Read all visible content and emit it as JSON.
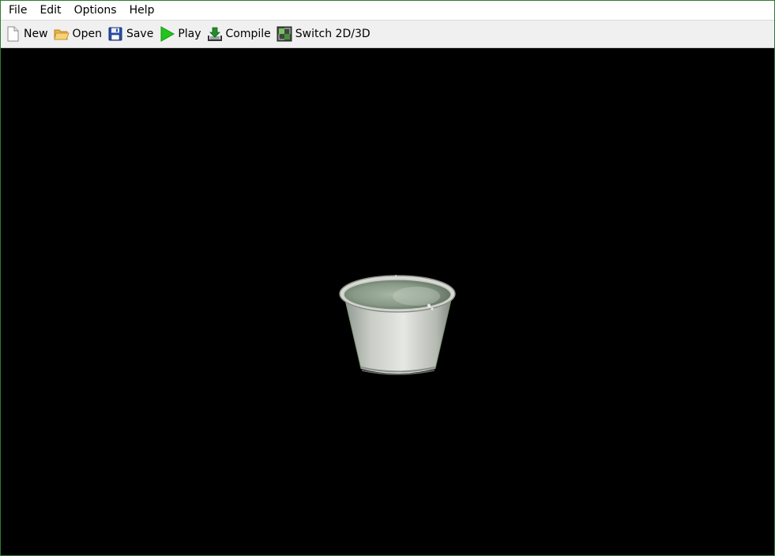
{
  "menubar": {
    "items": [
      {
        "label": "File"
      },
      {
        "label": "Edit"
      },
      {
        "label": "Options"
      },
      {
        "label": "Help"
      }
    ]
  },
  "toolbar": {
    "buttons": [
      {
        "label": "New",
        "icon": "new-file-icon"
      },
      {
        "label": "Open",
        "icon": "folder-open-icon"
      },
      {
        "label": "Save",
        "icon": "floppy-disk-icon"
      },
      {
        "label": "Play",
        "icon": "play-icon"
      },
      {
        "label": "Compile",
        "icon": "compile-download-icon"
      },
      {
        "label": "Switch 2D/3D",
        "icon": "switch-2d-3d-icon"
      }
    ]
  },
  "viewport": {
    "background": "#000000",
    "model": "cup-3d-model"
  },
  "colors": {
    "frame_border": "#2e7d32",
    "toolbar_bg": "#f0f0f0",
    "menubar_bg": "#ffffff",
    "play_green": "#22c41e"
  }
}
